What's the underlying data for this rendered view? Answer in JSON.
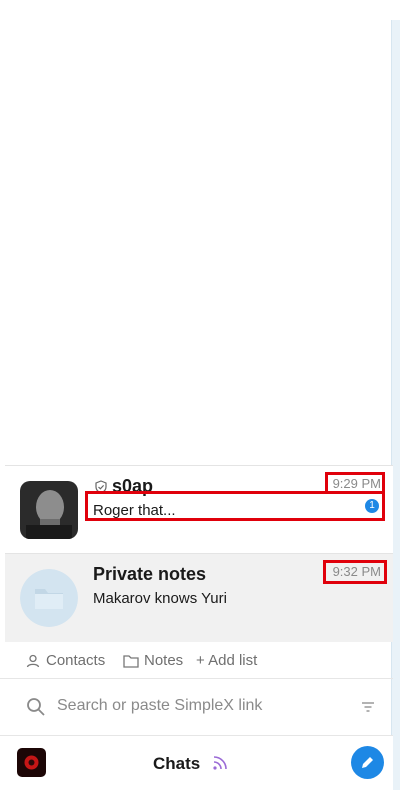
{
  "chats": [
    {
      "name": "s0ap",
      "preview": "Roger that...",
      "time": "9:29 PM",
      "unread": "1"
    },
    {
      "name": "Private notes",
      "preview": "Makarov knows Yuri",
      "time": "9:32 PM"
    }
  ],
  "filters": {
    "contacts": "Contacts",
    "notes": "Notes",
    "add_list": "+ Add list"
  },
  "search": {
    "placeholder": "Search or paste SimpleX link"
  },
  "bottom": {
    "title": "Chats"
  },
  "colors": {
    "accent": "#1e88e5",
    "highlight": "#e0000b",
    "rss": "#9b6bd6"
  }
}
